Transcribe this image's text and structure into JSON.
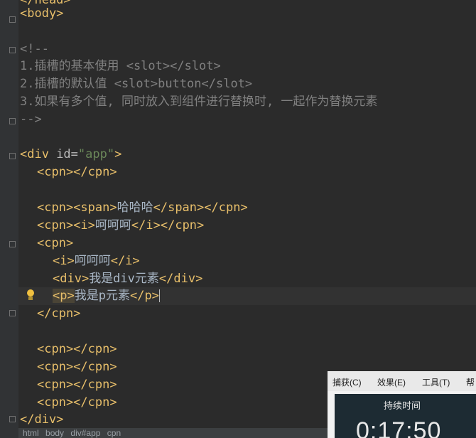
{
  "editor": {
    "lines": {
      "l0": "</head>",
      "l1": "<body>",
      "l3": "<!--",
      "l4": "1.插槽的基本使用 <slot></slot>",
      "l5": "2.插槽的默认值 <slot>button</slot>",
      "l6": "3.如果有多个值, 同时放入到组件进行替换时, 一起作为替换元素",
      "l7": "-->",
      "l9_open": "<div ",
      "l9_attr": "id=",
      "l9_str": "\"app\"",
      "l9_close": ">",
      "l10": "<cpn></cpn>",
      "l12_a": "<cpn>",
      "l12_b": "<span>",
      "l12_text": "哈哈哈",
      "l12_c": "</span>",
      "l12_d": "</cpn>",
      "l13_a": "<cpn>",
      "l13_b": "<i>",
      "l13_text": "呵呵呵",
      "l13_c": "</i>",
      "l13_d": "</cpn>",
      "l14": "<cpn>",
      "l15_a": "<i>",
      "l15_text": "呵呵呵",
      "l15_b": "</i>",
      "l16_a": "<div>",
      "l16_text": "我是div元素",
      "l16_b": "</div>",
      "l17_a": "<p>",
      "l17_text": "我是p元素",
      "l17_b": "</p>",
      "l18": "</cpn>",
      "l20": "<cpn></cpn>",
      "l21": "<cpn></cpn>",
      "l22": "<cpn></cpn>",
      "l23": "<cpn></cpn>",
      "l24": "</div>"
    }
  },
  "breadcrumb": {
    "items": [
      "html",
      "body",
      "div#app",
      "cpn"
    ]
  },
  "recorder": {
    "menu": [
      "捕获(C)",
      "效果(E)",
      "工具(T)",
      "帮"
    ],
    "timer_label": "持续时间",
    "timer_value": "0:17:50"
  },
  "colors": {
    "background": "#2b2b2b",
    "tag": "#e8bf6a",
    "comment": "#808080",
    "string": "#6a8759",
    "text": "#a9b7c6"
  },
  "icons": [
    "lightbulb-icon",
    "fold-marker-icon"
  ]
}
